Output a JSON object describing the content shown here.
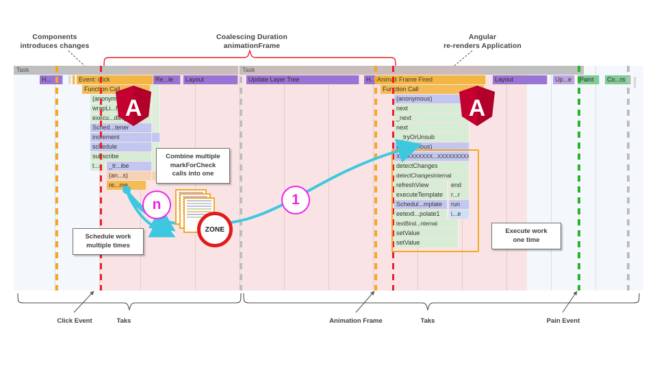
{
  "annotations": {
    "top_left": "Components\ninstroduces changes",
    "top_left_text": "Components\nintroduces changes",
    "top_center": "Coalescing Duration\nanimationFrame",
    "top_right": "Angular\nre-renders Application"
  },
  "callouts": {
    "combine": "Combine multiple\nmarkForCheck\ncalls into one",
    "schedule": "Schedule work\nmultiple times",
    "execute": "Execute work\none time"
  },
  "markers": {
    "n_circle": "n",
    "one_circle": "1",
    "zone": "ZONE"
  },
  "bottom_labels": [
    "Click Event",
    "Taks",
    "Animation Frame",
    "Taks",
    "Pain Event"
  ],
  "tracks": {
    "task_header_left": "Task",
    "task_header_right": "Task",
    "left_row1": [
      "H...",
      "Event: click",
      "Re...le",
      "Layout"
    ],
    "left_stack": [
      "Function Call",
      "(anonymous)",
      "wrapLi...fault",
      "execu...dling",
      "Sched...tener",
      "increment",
      "schedule",
      "subscribe",
      "t...r",
      "_tr...ibe",
      "(an...s)",
      "re...me"
    ],
    "right_row1": [
      "Update Layer Tree",
      "H...t",
      "Animation",
      "Frame Fired",
      "Layout",
      "Up...e",
      "Paint",
      "Co...rs"
    ],
    "right_stack": [
      "Function Call",
      "(anonymous)",
      "next",
      "_next",
      "next",
      "__tryOrUnsub",
      "(anonymous)",
      "XXXXXXXXXX...XXXXXXXXX",
      "detectChanges",
      "detectChangesInternal",
      "refreshView",
      "executeTemplate",
      "Schedul...mplate",
      "eetextl...polate1",
      "textBind...nternal",
      "setValue",
      "setValue"
    ],
    "right_stack_side": [
      "end",
      "r...r",
      "run",
      "i...e"
    ]
  },
  "colors": {
    "accent_red": "#e8202a",
    "accent_orange": "#f5a623",
    "accent_green": "#2bb42b",
    "accent_magenta": "#ea25ea",
    "accent_cyan": "#3ec8e0",
    "angular_red": "#c3002f"
  },
  "logo": {
    "angular_letter": "A"
  }
}
